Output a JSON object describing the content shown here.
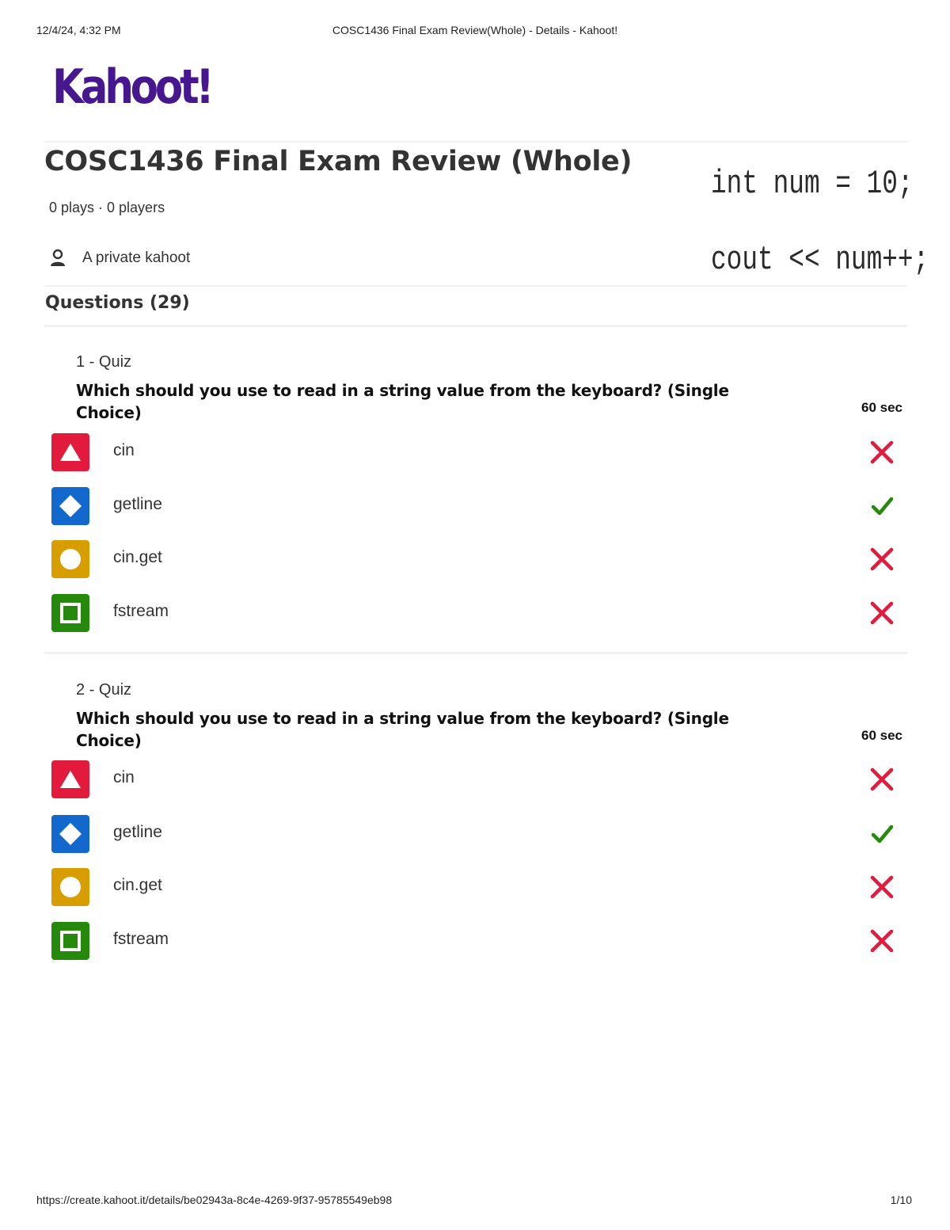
{
  "print_header": {
    "datetime": "12/4/24, 4:32 PM",
    "page_title": "COSC1436 Final Exam Review(Whole) - Details - Kahoot!"
  },
  "logo": {
    "text": "Kahoot!",
    "color": "#46178f"
  },
  "kahoot": {
    "title": "COSC1436 Final Exam Review (Whole)",
    "stats": "0 plays · 0 players",
    "visibility": "A private kahoot",
    "cover_code": [
      "int num = 10;",
      "cout << num++;"
    ]
  },
  "questions_heading": "Questions (29)",
  "colors": {
    "red": "#e21b3c",
    "blue": "#1368ce",
    "yellow": "#d89e00",
    "green": "#26890c",
    "correct": "#26890c",
    "incorrect": "#e21b3c"
  },
  "questions": [
    {
      "type": "1 - Quiz",
      "text": "Which should you use to read in a string value from the keyboard? (Single Choice)",
      "time": "60 sec",
      "answers": [
        {
          "label": "cin",
          "shape": "triangle-icon",
          "correct": false
        },
        {
          "label": "getline",
          "shape": "diamond-icon",
          "correct": true
        },
        {
          "label": "cin.get",
          "shape": "circle-icon",
          "correct": false
        },
        {
          "label": "fstream",
          "shape": "square-icon",
          "correct": false
        }
      ]
    },
    {
      "type": "2 - Quiz",
      "text": "Which should you use to read in a string value from the keyboard? (Single Choice)",
      "time": "60 sec",
      "answers": [
        {
          "label": "cin",
          "shape": "triangle-icon",
          "correct": false
        },
        {
          "label": "getline",
          "shape": "diamond-icon",
          "correct": true
        },
        {
          "label": "cin.get",
          "shape": "circle-icon",
          "correct": false
        },
        {
          "label": "fstream",
          "shape": "square-icon",
          "correct": false
        }
      ]
    }
  ],
  "print_footer": {
    "url": "https://create.kahoot.it/details/be02943a-8c4e-4269-9f37-95785549eb98",
    "page": "1/10"
  }
}
